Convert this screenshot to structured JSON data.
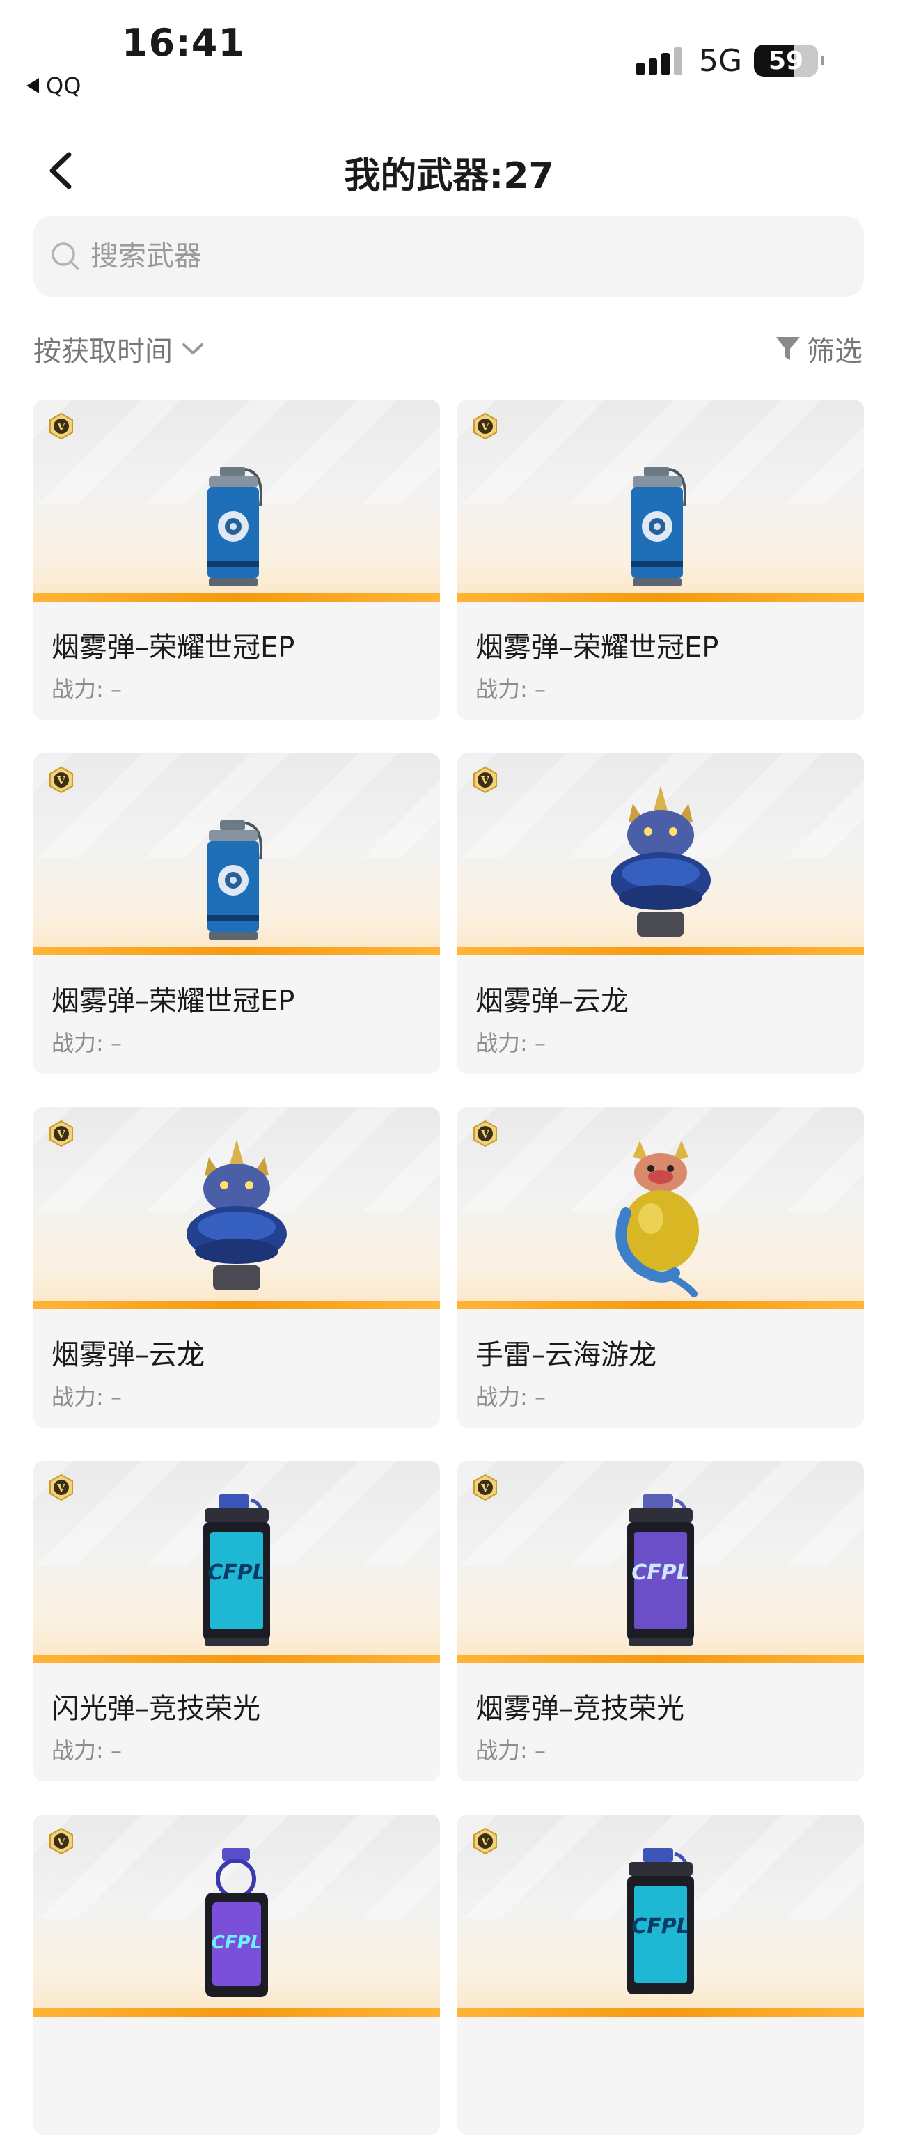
{
  "status": {
    "time": "16:41",
    "back_app": "QQ",
    "network": "5G",
    "battery": "59"
  },
  "header": {
    "title": "我的武器:27"
  },
  "search": {
    "placeholder": "搜索武器"
  },
  "toolbar": {
    "sort_label": "按获取时间",
    "filter_label": "筛选"
  },
  "power_prefix": "战力: –",
  "colors": {
    "accent_bar": "#f59a10",
    "card_bg": "#f5f5f5",
    "text_secondary": "#8d8d8d"
  },
  "items": [
    {
      "name": "烟雾弹–荣耀世冠EP",
      "power": "战力: –",
      "art": "smoke-can-blue"
    },
    {
      "name": "烟雾弹–荣耀世冠EP",
      "power": "战力: –",
      "art": "smoke-can-blue"
    },
    {
      "name": "烟雾弹–荣耀世冠EP",
      "power": "战力: –",
      "art": "smoke-can-blue"
    },
    {
      "name": "烟雾弹–云龙",
      "power": "战力: –",
      "art": "dragon"
    },
    {
      "name": "烟雾弹–云龙",
      "power": "战力: –",
      "art": "dragon"
    },
    {
      "name": "手雷–云海游龙",
      "power": "战力: –",
      "art": "gold-dragon"
    },
    {
      "name": "闪光弹–竞技荣光",
      "power": "战力: –",
      "art": "cyan-can"
    },
    {
      "name": "烟雾弹–竞技荣光",
      "power": "战力: –",
      "art": "purple-can"
    },
    {
      "name": "",
      "power": "",
      "art": "purple-grenade"
    },
    {
      "name": "",
      "power": "",
      "art": "cyan-can"
    }
  ]
}
